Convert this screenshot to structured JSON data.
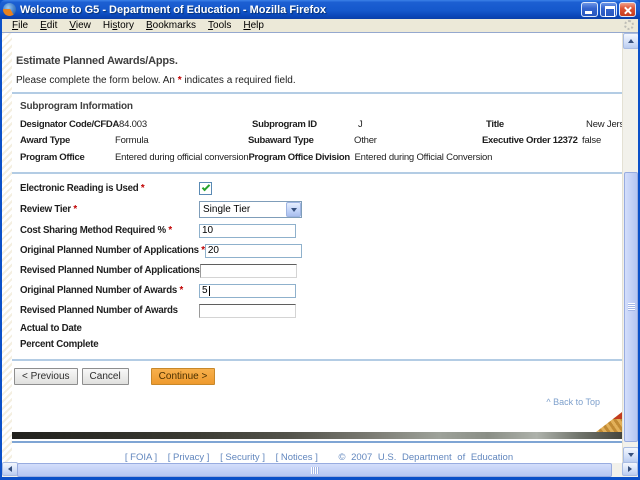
{
  "window": {
    "title": "Welcome to G5 - Department of Education - Mozilla Firefox",
    "icons": {
      "app": "firefox-icon",
      "minimize": "minimize-icon",
      "restore": "restore-icon",
      "close": "close-icon",
      "throbber": "throbber-icon"
    }
  },
  "menu": {
    "items": [
      {
        "pre": "",
        "key": "F",
        "post": "ile"
      },
      {
        "pre": "",
        "key": "E",
        "post": "dit"
      },
      {
        "pre": "",
        "key": "V",
        "post": "iew"
      },
      {
        "pre": "Hi",
        "key": "s",
        "post": "tory"
      },
      {
        "pre": "",
        "key": "B",
        "post": "ookmarks"
      },
      {
        "pre": "",
        "key": "T",
        "post": "ools"
      },
      {
        "pre": "",
        "key": "H",
        "post": "elp"
      }
    ]
  },
  "content": {
    "heading": "Estimate Planned Awards/Apps.",
    "intro": {
      "before": "Please complete the form below. An ",
      "star": "*",
      "after": " indicates a required field."
    },
    "section_title": "Subprogram Information",
    "info_rows": [
      {
        "cells": [
          {
            "label": "Designator Code/CFDA",
            "value": "84.003"
          },
          {
            "label": "Subprogram ID",
            "value": "J"
          },
          {
            "label": "Title",
            "value": "New Jersey S"
          }
        ]
      },
      {
        "cells": [
          {
            "label": "Award Type",
            "value": "Formula"
          },
          {
            "label": "Subaward Type",
            "value": "Other"
          },
          {
            "label": "Executive Order 12372",
            "value": "false"
          }
        ]
      },
      {
        "cells": [
          {
            "label": "Program Office",
            "value": "Entered during official conversion"
          },
          {
            "label": "Program Office Division",
            "value": "Entered during Official Conversion"
          },
          {
            "label": "",
            "value": ""
          }
        ]
      }
    ],
    "form": {
      "star": "*",
      "fields": [
        {
          "label": "Electronic Reading is Used",
          "required": true,
          "type": "checkbox",
          "checked": true
        },
        {
          "label": "Review Tier",
          "required": true,
          "type": "select",
          "value": "Single Tier"
        },
        {
          "label": "Cost Sharing Method Required %",
          "required": true,
          "type": "text",
          "value": "10"
        },
        {
          "label": "Original Planned Number of Applications",
          "required": true,
          "type": "text",
          "value": "20"
        },
        {
          "label": "Revised Planned Number of Applications",
          "required": false,
          "type": "text",
          "value": ""
        },
        {
          "label": "Original Planned Number of Awards",
          "required": true,
          "type": "text",
          "value": "5",
          "focused": true
        },
        {
          "label": "Revised Planned Number of Awards",
          "required": false,
          "type": "text",
          "value": ""
        },
        {
          "label": "Actual to Date",
          "required": false,
          "type": "static"
        },
        {
          "label": "Percent Complete",
          "required": false,
          "type": "static"
        }
      ]
    },
    "buttons": {
      "previous": "< Previous",
      "cancel": "Cancel",
      "continue": "Continue >"
    },
    "back_to_top": "^ Back to Top"
  },
  "footer": {
    "links": [
      "[ FOIA ]",
      "[ Privacy ]",
      "[ Security ]",
      "[ Notices ]"
    ],
    "copyright": "©  2007  U.S.  Department  of  Education"
  }
}
